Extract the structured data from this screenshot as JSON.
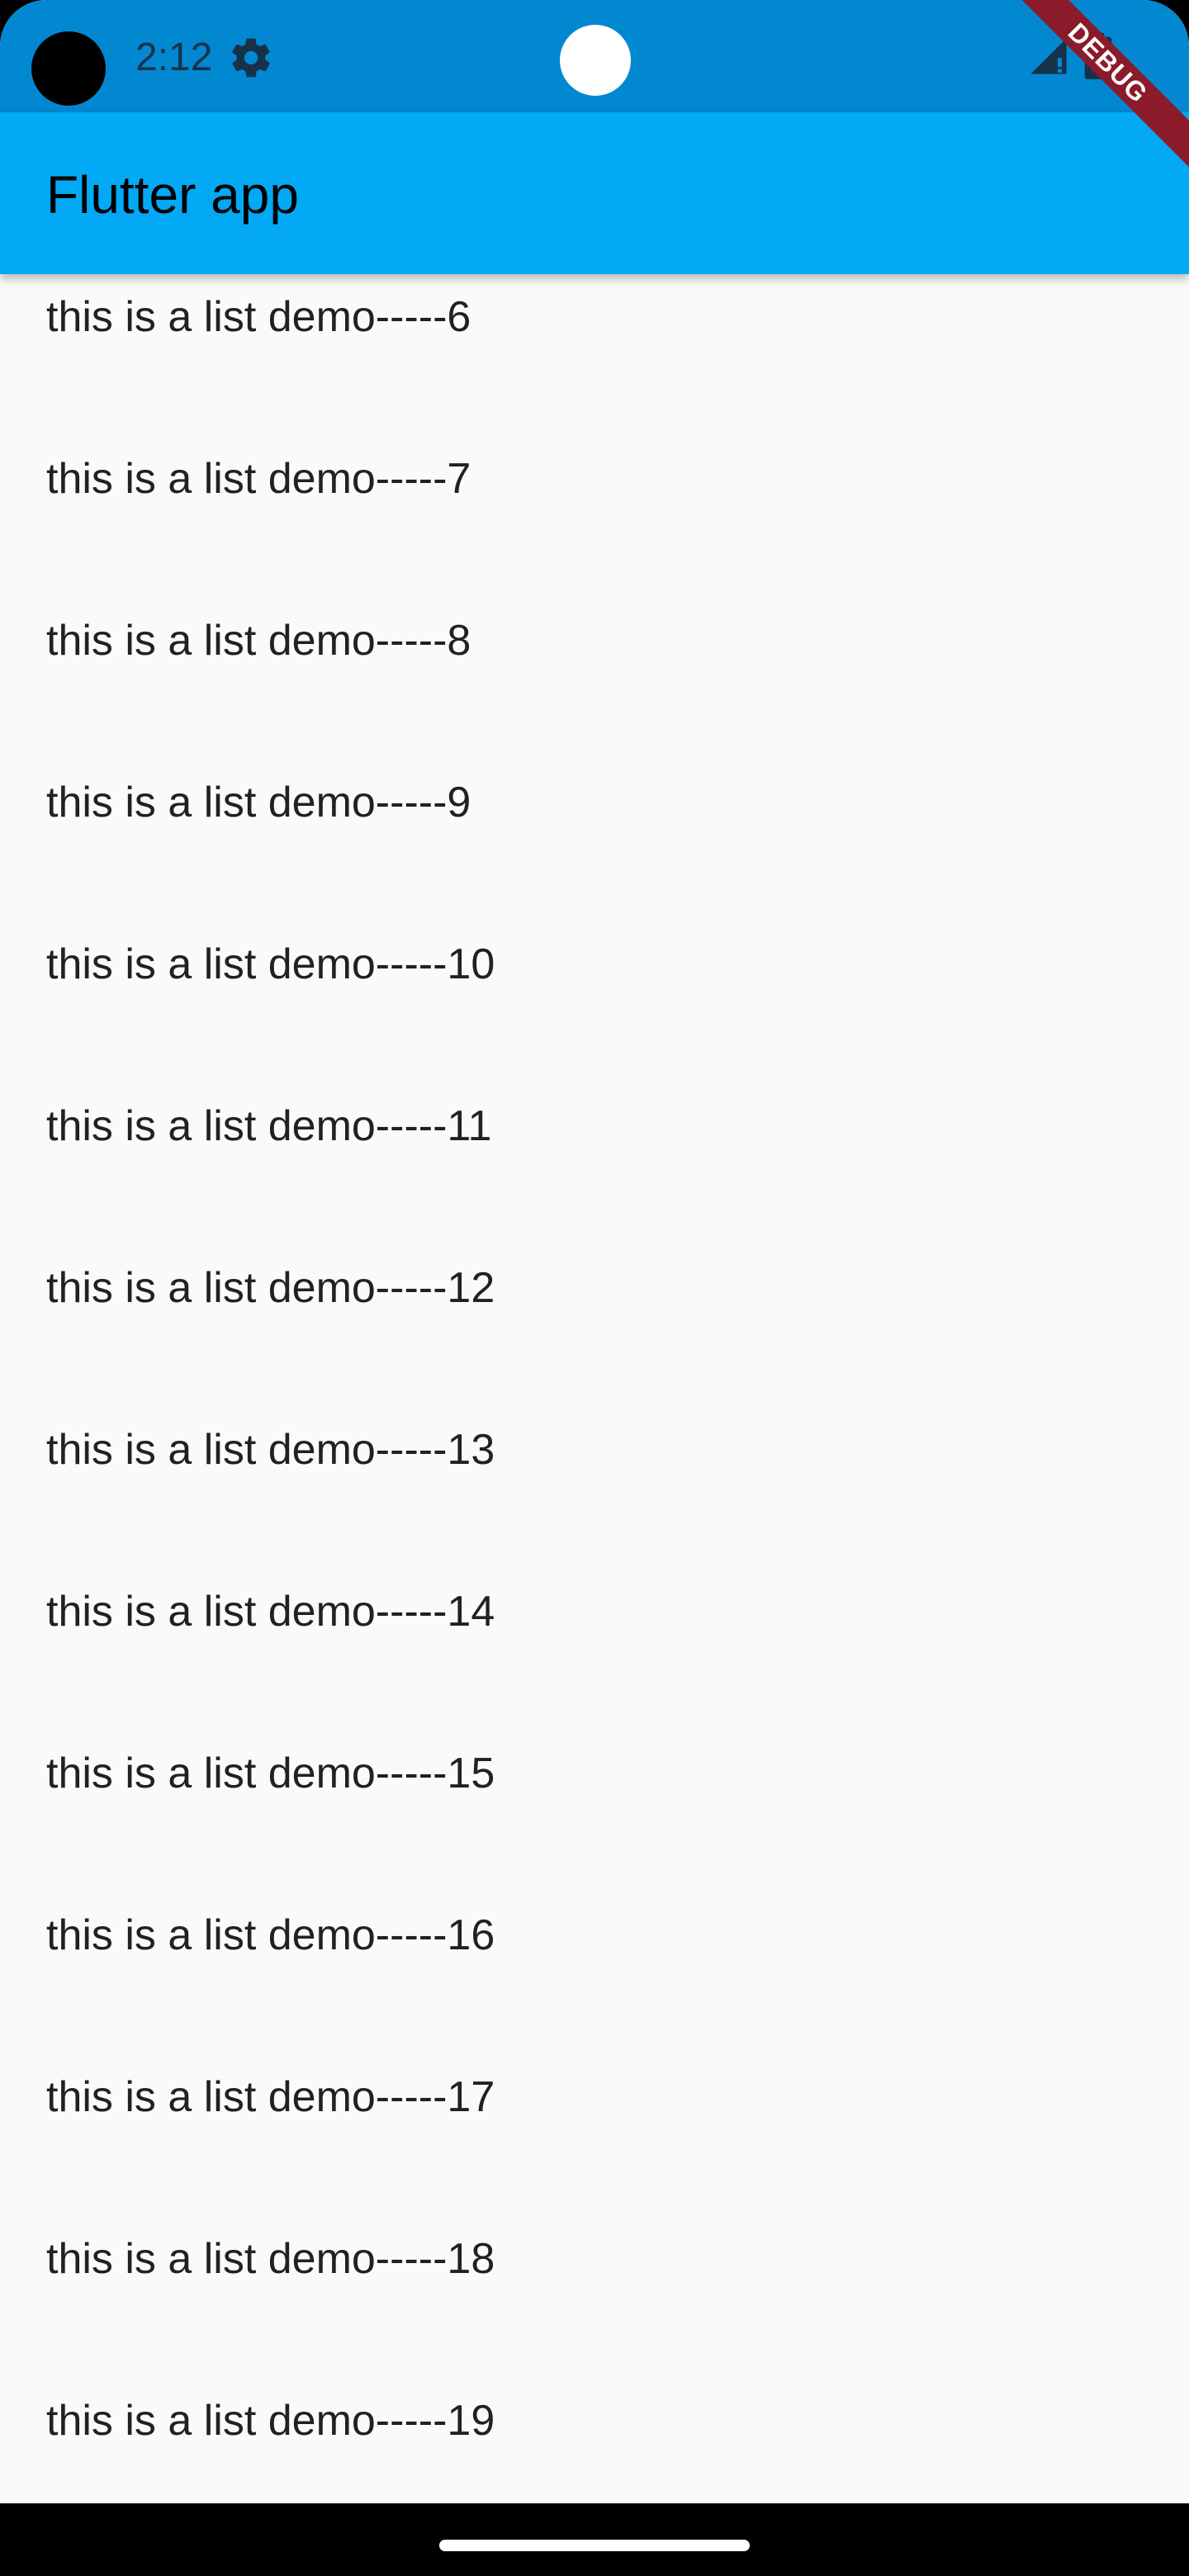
{
  "status_bar": {
    "time": "2:12",
    "icons": [
      "settings-gear-icon",
      "cellular-signal-icon",
      "battery-icon"
    ],
    "background_color": "#0288d1"
  },
  "app_bar": {
    "title": "Flutter app",
    "background_color": "#03a9f4"
  },
  "debug_banner": {
    "label": "DEBUG",
    "color": "#8b1a2a"
  },
  "list": {
    "items": [
      {
        "label": "this is a list demo-----6"
      },
      {
        "label": "this is a list demo-----7"
      },
      {
        "label": "this is a list demo-----8"
      },
      {
        "label": "this is a list demo-----9"
      },
      {
        "label": "this is a list demo-----10"
      },
      {
        "label": "this is a list demo-----11"
      },
      {
        "label": "this is a list demo-----12"
      },
      {
        "label": "this is a list demo-----13"
      },
      {
        "label": "this is a list demo-----14"
      },
      {
        "label": "this is a list demo-----15"
      },
      {
        "label": "this is a list demo-----16"
      },
      {
        "label": "this is a list demo-----17"
      },
      {
        "label": "this is a list demo-----18"
      },
      {
        "label": "this is a list demo-----19"
      }
    ]
  }
}
